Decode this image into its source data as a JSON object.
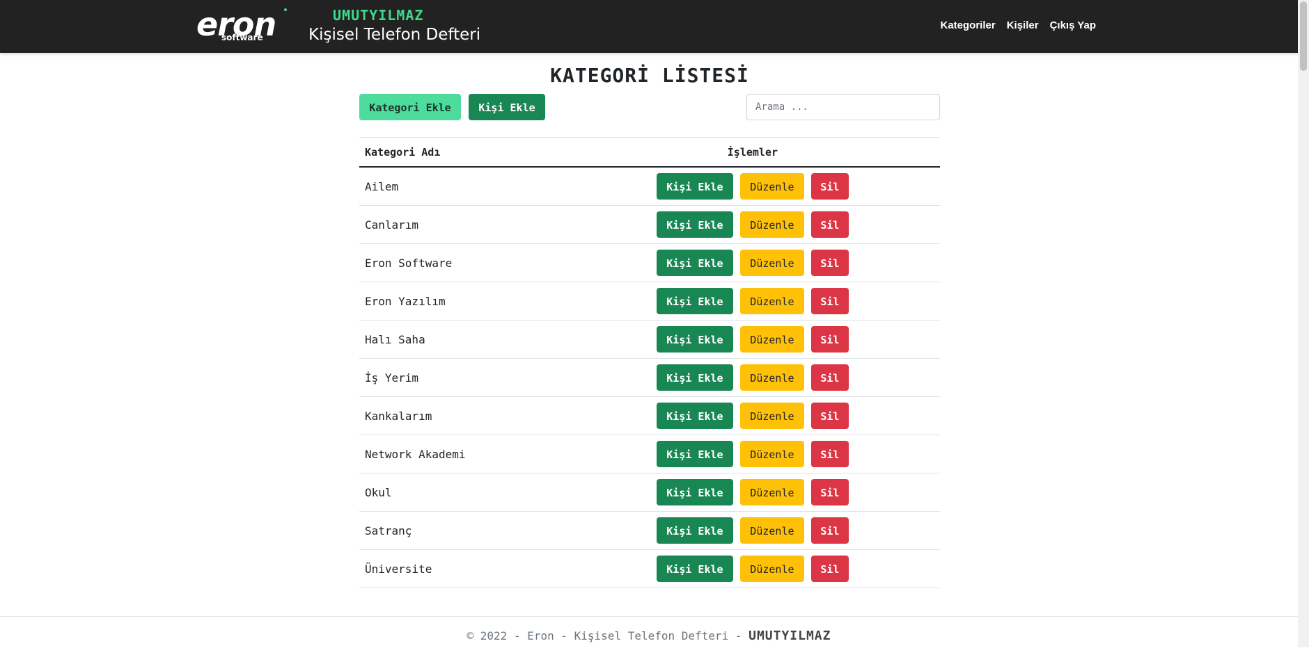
{
  "header": {
    "logo": {
      "word": "eron",
      "sub": "software"
    },
    "author": "UMUTYILMAZ",
    "app_title": "Kişisel Telefon Defteri",
    "nav": [
      {
        "label": "Kategoriler",
        "icon": ""
      },
      {
        "label": "Kişiler",
        "icon": ""
      },
      {
        "label": "Çıkış Yap",
        "icon": ""
      }
    ]
  },
  "main": {
    "title": "KATEGORİ LİSTESİ",
    "add_category_label": "Kategori Ekle",
    "add_person_label": "Kişi Ekle",
    "search": {
      "placeholder": "Arama ...",
      "value": ""
    },
    "table": {
      "headers": [
        "Kategori Adı",
        "İşlemler"
      ],
      "rows": [
        {
          "name": "Ailem"
        },
        {
          "name": "Canlarım"
        },
        {
          "name": "Eron Software"
        },
        {
          "name": "Eron Yazılım"
        },
        {
          "name": "Halı Saha"
        },
        {
          "name": "İş Yerim"
        },
        {
          "name": "Kankalarım"
        },
        {
          "name": "Network Akademi"
        },
        {
          "name": "Okul"
        },
        {
          "name": "Satranç"
        },
        {
          "name": "Üniversite"
        }
      ],
      "actions": {
        "add": "Kişi Ekle",
        "edit": "Düzenle",
        "delete": "Sil"
      }
    }
  },
  "footer": {
    "text": "© 2022 - Eron - Kişisel Telefon Defteri -",
    "author": "UMUTYILMAZ"
  },
  "colors": {
    "navbar": "#222222",
    "author_accent": "#3fd98a",
    "btn_green": "#198754",
    "btn_light_green": "#4ddc9c",
    "btn_yellow": "#ffc107",
    "btn_red": "#dc3545"
  }
}
